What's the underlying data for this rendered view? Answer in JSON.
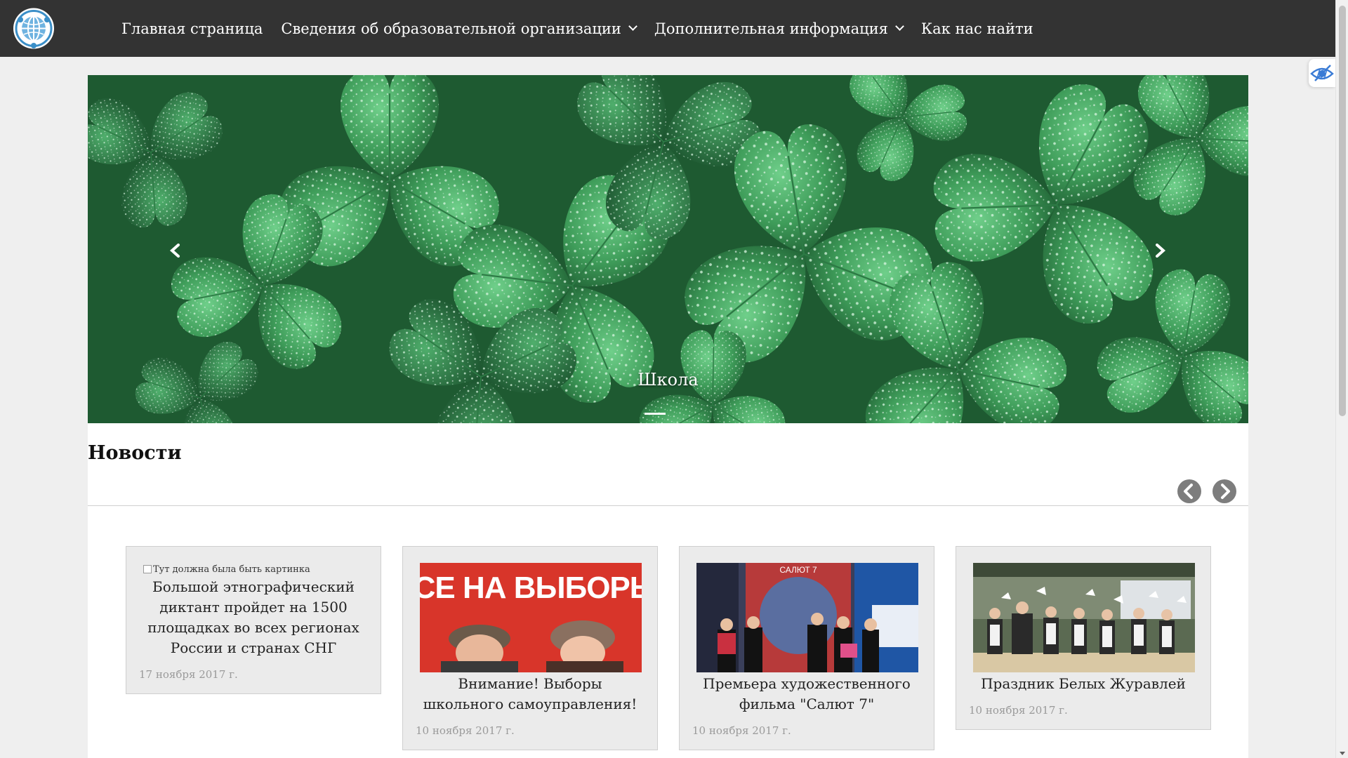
{
  "nav": {
    "items": [
      {
        "label": "Главная страница",
        "dropdown": false
      },
      {
        "label": "Сведения об образовательной организации",
        "dropdown": true
      },
      {
        "label": "Дополнительная информация",
        "dropdown": true
      },
      {
        "label": "Как нас найти",
        "dropdown": false
      }
    ]
  },
  "slider": {
    "caption": "Школа",
    "slide_count": 1,
    "active_index": 0
  },
  "news": {
    "heading": "Новости",
    "cards": [
      {
        "image_alt": "Тут должна была быть картинка",
        "title": "Большой этнографический диктант пройдет на 1500 площадках во всех регионах России и странах СНГ",
        "date": "17 ноября 2017 г."
      },
      {
        "poster_text": "ВСЕ НА ВЫБОРЫ!",
        "title": "Внимание! Выборы школьного самоуправления!",
        "date": "10 ноября 2017 г."
      },
      {
        "poster_text": "САЛЮТ 7",
        "title": "Премьера художественного фильма \"Салют 7\"",
        "date": "10 ноября 2017 г."
      },
      {
        "title": "Праздник Белых Журавлей",
        "date": "10 ноября 2017 г."
      }
    ]
  },
  "colors": {
    "topbar": "#333333",
    "page_bg": "#efefef",
    "card_bg": "#ebebeb",
    "date_text": "#9a9a9a",
    "clover_green": "#3f9d5a"
  },
  "icons": {
    "logo": "globe-logo-icon",
    "accessibility": "low-vision-eye-icon",
    "slider_prev": "chevron-left-icon",
    "slider_next": "chevron-right-icon",
    "news_prev": "circle-chevron-left-icon",
    "news_next": "circle-chevron-right-icon"
  }
}
